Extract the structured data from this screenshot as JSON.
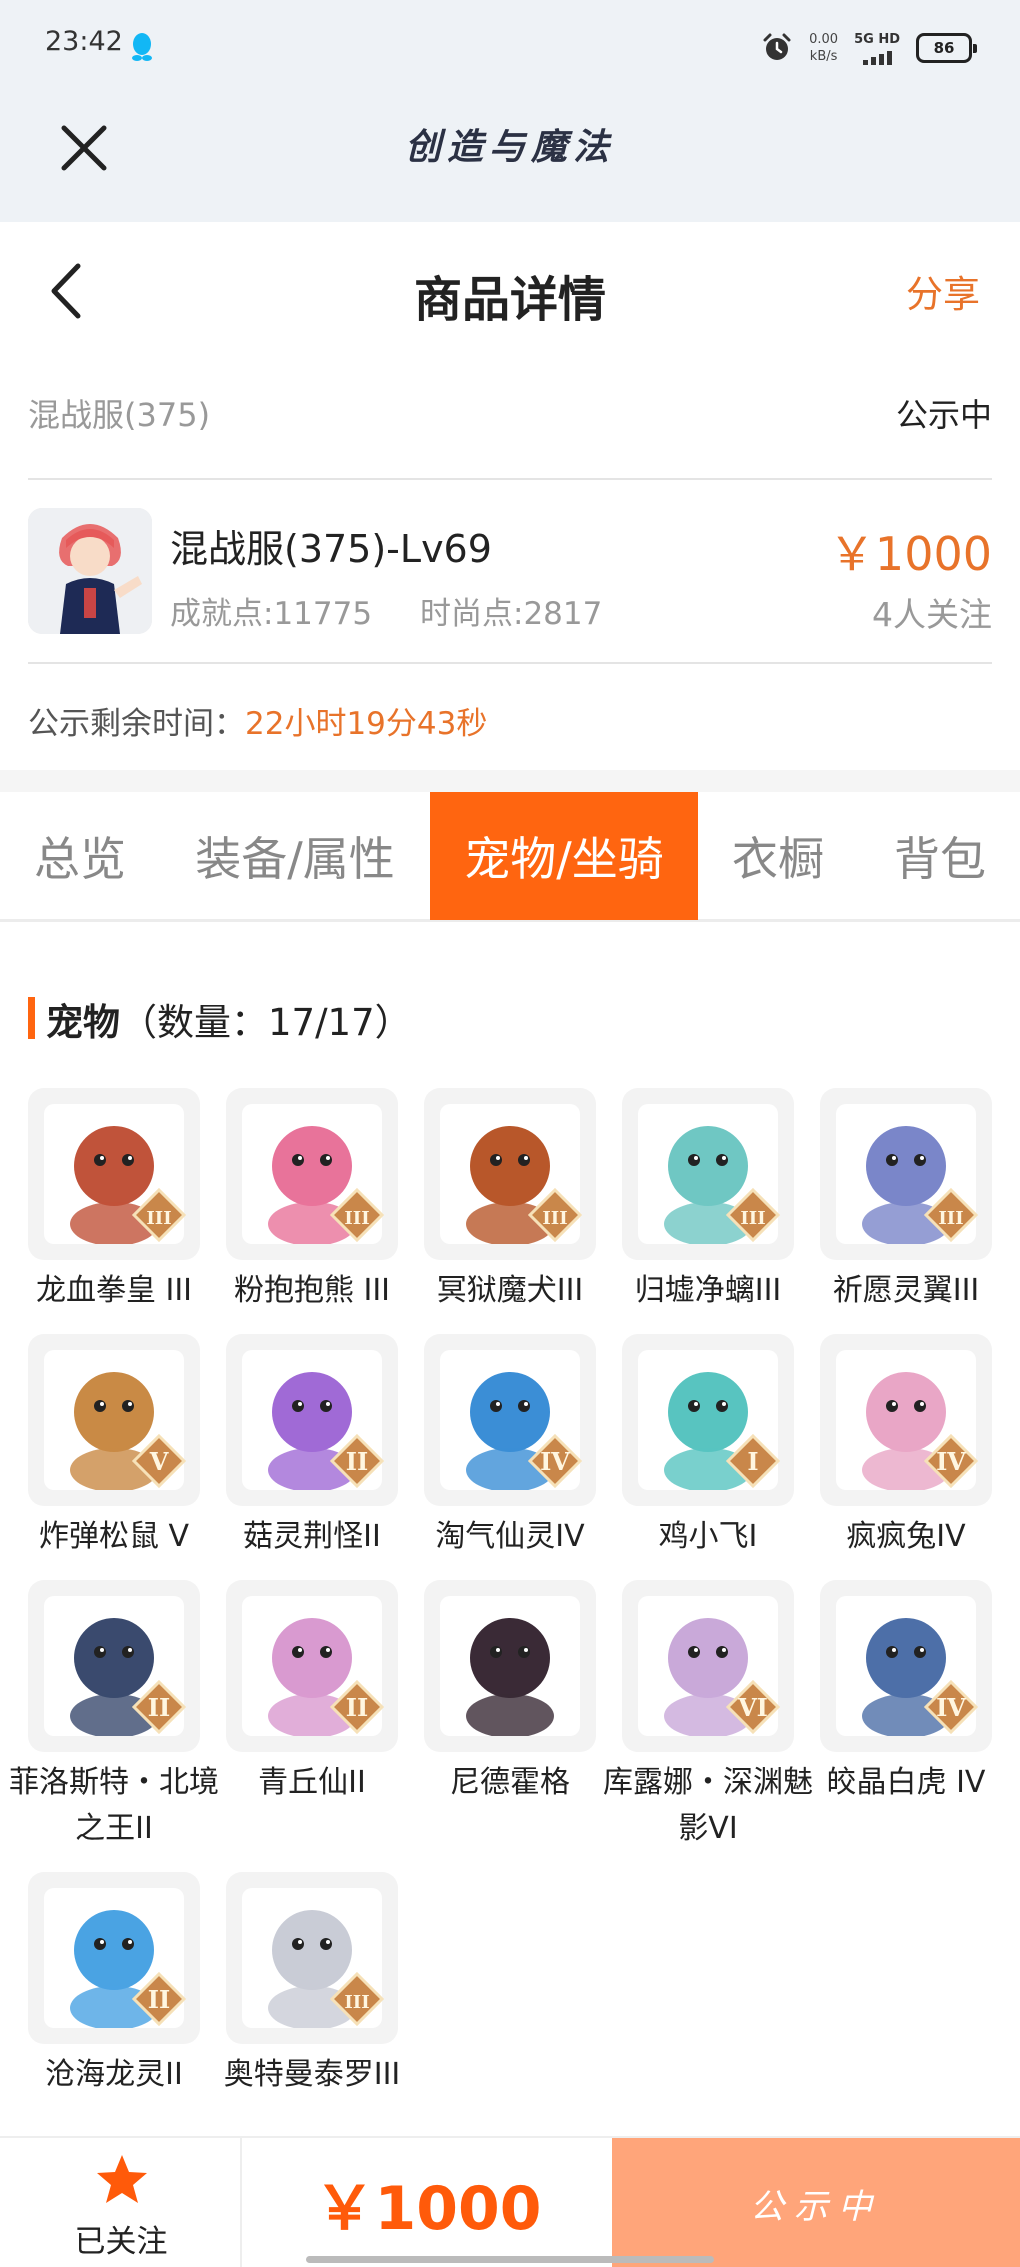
{
  "status_bar": {
    "time": "23:42",
    "net_speed_value": "0.00",
    "net_speed_unit": "kB/s",
    "signal_label": "5G HD",
    "battery": "86"
  },
  "app": {
    "title": "创造与魔法"
  },
  "header": {
    "title": "商品详情",
    "share_label": "分享"
  },
  "listing": {
    "server": "混战服(375)",
    "status": "公示中",
    "character_name": "混战服(375)-Lv69",
    "achievement": "成就点:11775",
    "fashion": "时尚点:2817",
    "price": "￥1000",
    "watchers": "4人关注",
    "remaining_label": "公示剩余时间：",
    "remaining_time": "22小时19分43秒"
  },
  "tabs": [
    {
      "label": "总览",
      "active": false
    },
    {
      "label": "装备/属性",
      "active": false
    },
    {
      "label": "宠物/坐骑",
      "active": true
    },
    {
      "label": "衣橱",
      "active": false
    },
    {
      "label": "背包",
      "active": false
    }
  ],
  "pets_section": {
    "title": "宠物",
    "count_text": "（数量：17/17）",
    "pets": [
      {
        "name": "龙血拳皇 III",
        "tier": "III",
        "color": "#c0533a"
      },
      {
        "name": "粉抱抱熊 III",
        "tier": "III",
        "color": "#e8739a"
      },
      {
        "name": "冥狱魔犬III",
        "tier": "III",
        "color": "#b8572a"
      },
      {
        "name": "归墟净螭III",
        "tier": "III",
        "color": "#6fc7c3"
      },
      {
        "name": "祈愿灵翼III",
        "tier": "III",
        "color": "#7a86c9"
      },
      {
        "name": "炸弹松鼠 V",
        "tier": "V",
        "color": "#c98a45"
      },
      {
        "name": "菇灵荆怪II",
        "tier": "II",
        "color": "#a06ad6"
      },
      {
        "name": "淘气仙灵IV",
        "tier": "IV",
        "color": "#3b8ed6"
      },
      {
        "name": "鸡小飞I",
        "tier": "I",
        "color": "#58c4c0"
      },
      {
        "name": "疯疯兔IV",
        "tier": "IV",
        "color": "#e9a6c6"
      },
      {
        "name": "菲洛斯特・北境之王II",
        "tier": "II",
        "color": "#3a4a6e"
      },
      {
        "name": "青丘仙II",
        "tier": "II",
        "color": "#d99ad0"
      },
      {
        "name": "尼德霍格",
        "tier": "",
        "color": "#3a2a36"
      },
      {
        "name": "库露娜・深渊魅影VI",
        "tier": "VI",
        "color": "#c9a9d9"
      },
      {
        "name": "皎晶白虎 IV",
        "tier": "IV",
        "color": "#4d6fa8"
      },
      {
        "name": "沧海龙灵II",
        "tier": "II",
        "color": "#4aa3e3"
      },
      {
        "name": "奥特曼泰罗III",
        "tier": "III",
        "color": "#c9ccd6"
      }
    ]
  },
  "bottom_bar": {
    "follow_label": "已关注",
    "price": "￥1000",
    "action_label": "公示中"
  },
  "colors": {
    "accent": "#ff6510",
    "price": "#e8732a",
    "button_disabled": "#ffa57a"
  }
}
